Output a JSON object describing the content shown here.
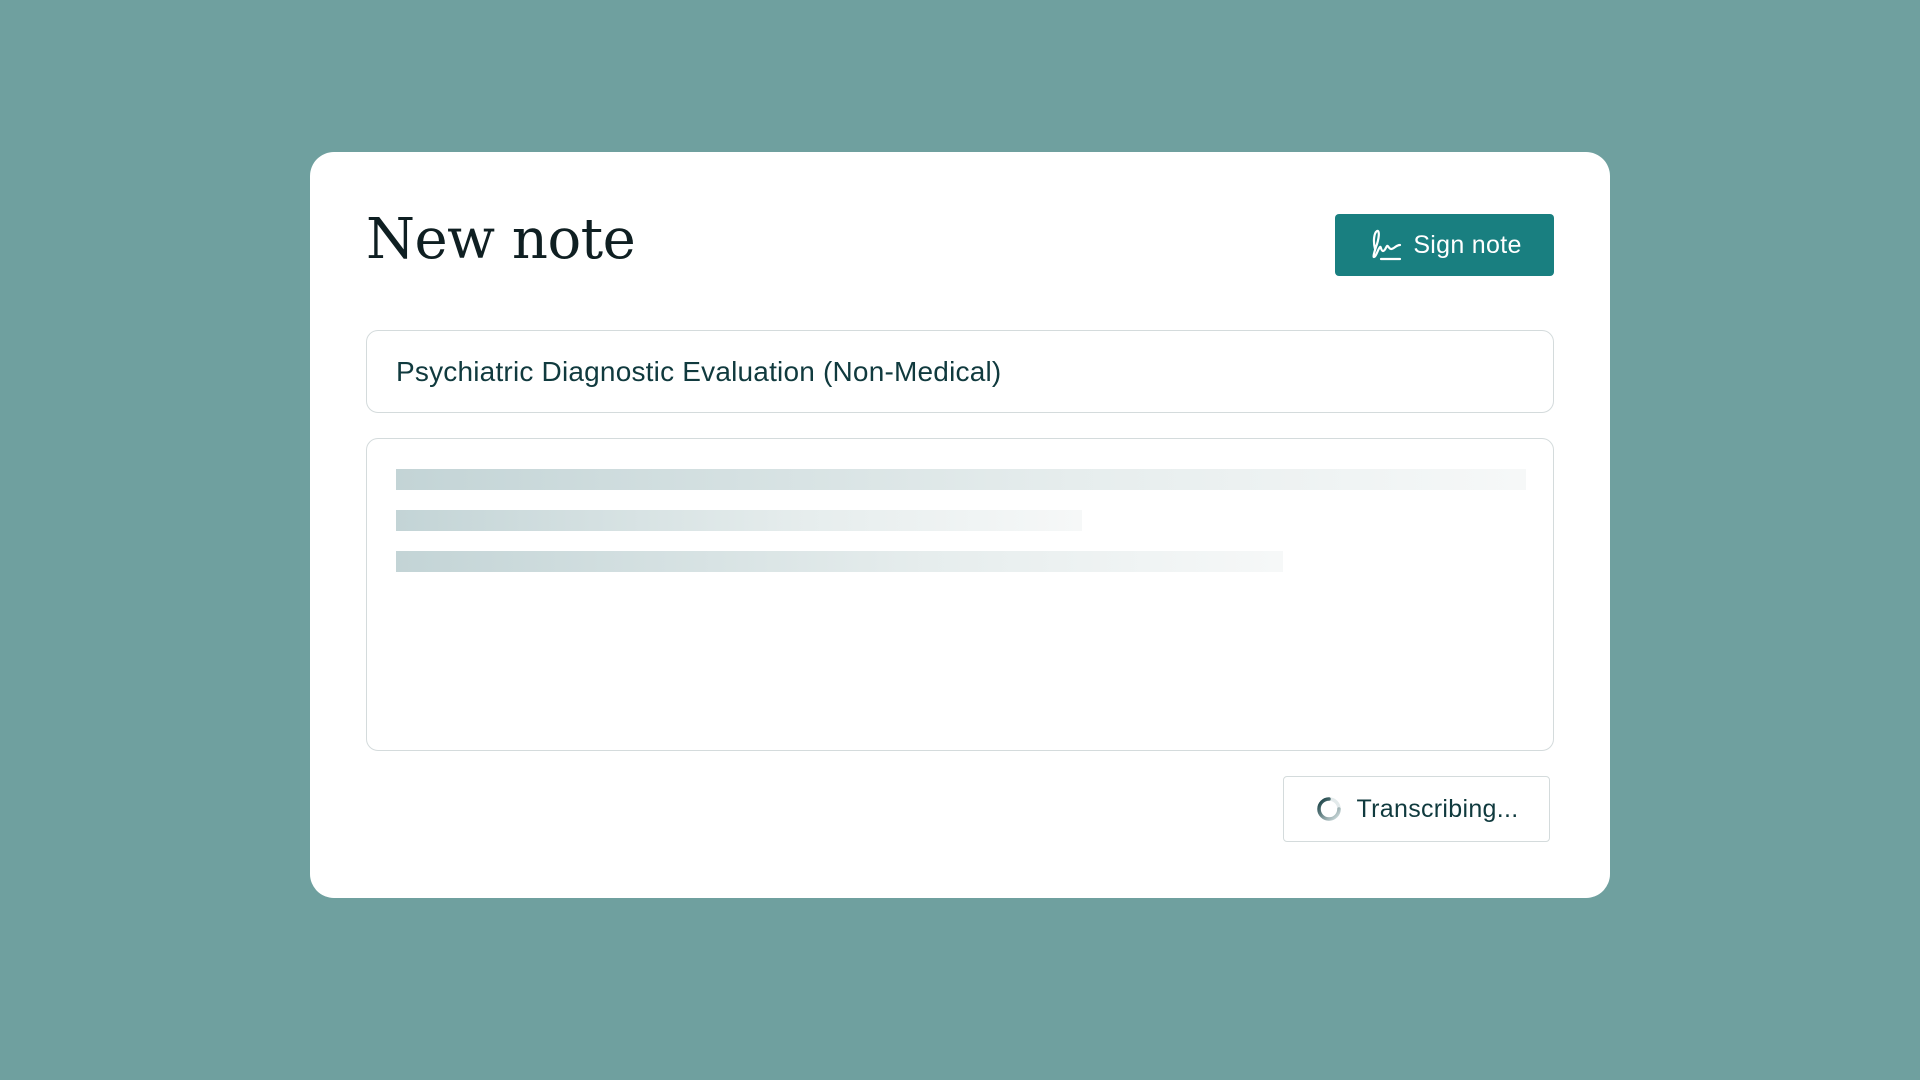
{
  "header": {
    "title": "New note",
    "sign_label": "Sign note",
    "sign_icon": "signature-icon"
  },
  "template": {
    "value": "Psychiatric Diagnostic Evaluation (Non-Medical)"
  },
  "note": {
    "state": "loading"
  },
  "status": {
    "label": "Transcribing...",
    "icon": "spinner-icon"
  },
  "colors": {
    "background": "#6fa09f",
    "accent": "#197f80",
    "text": "#103a3e"
  }
}
